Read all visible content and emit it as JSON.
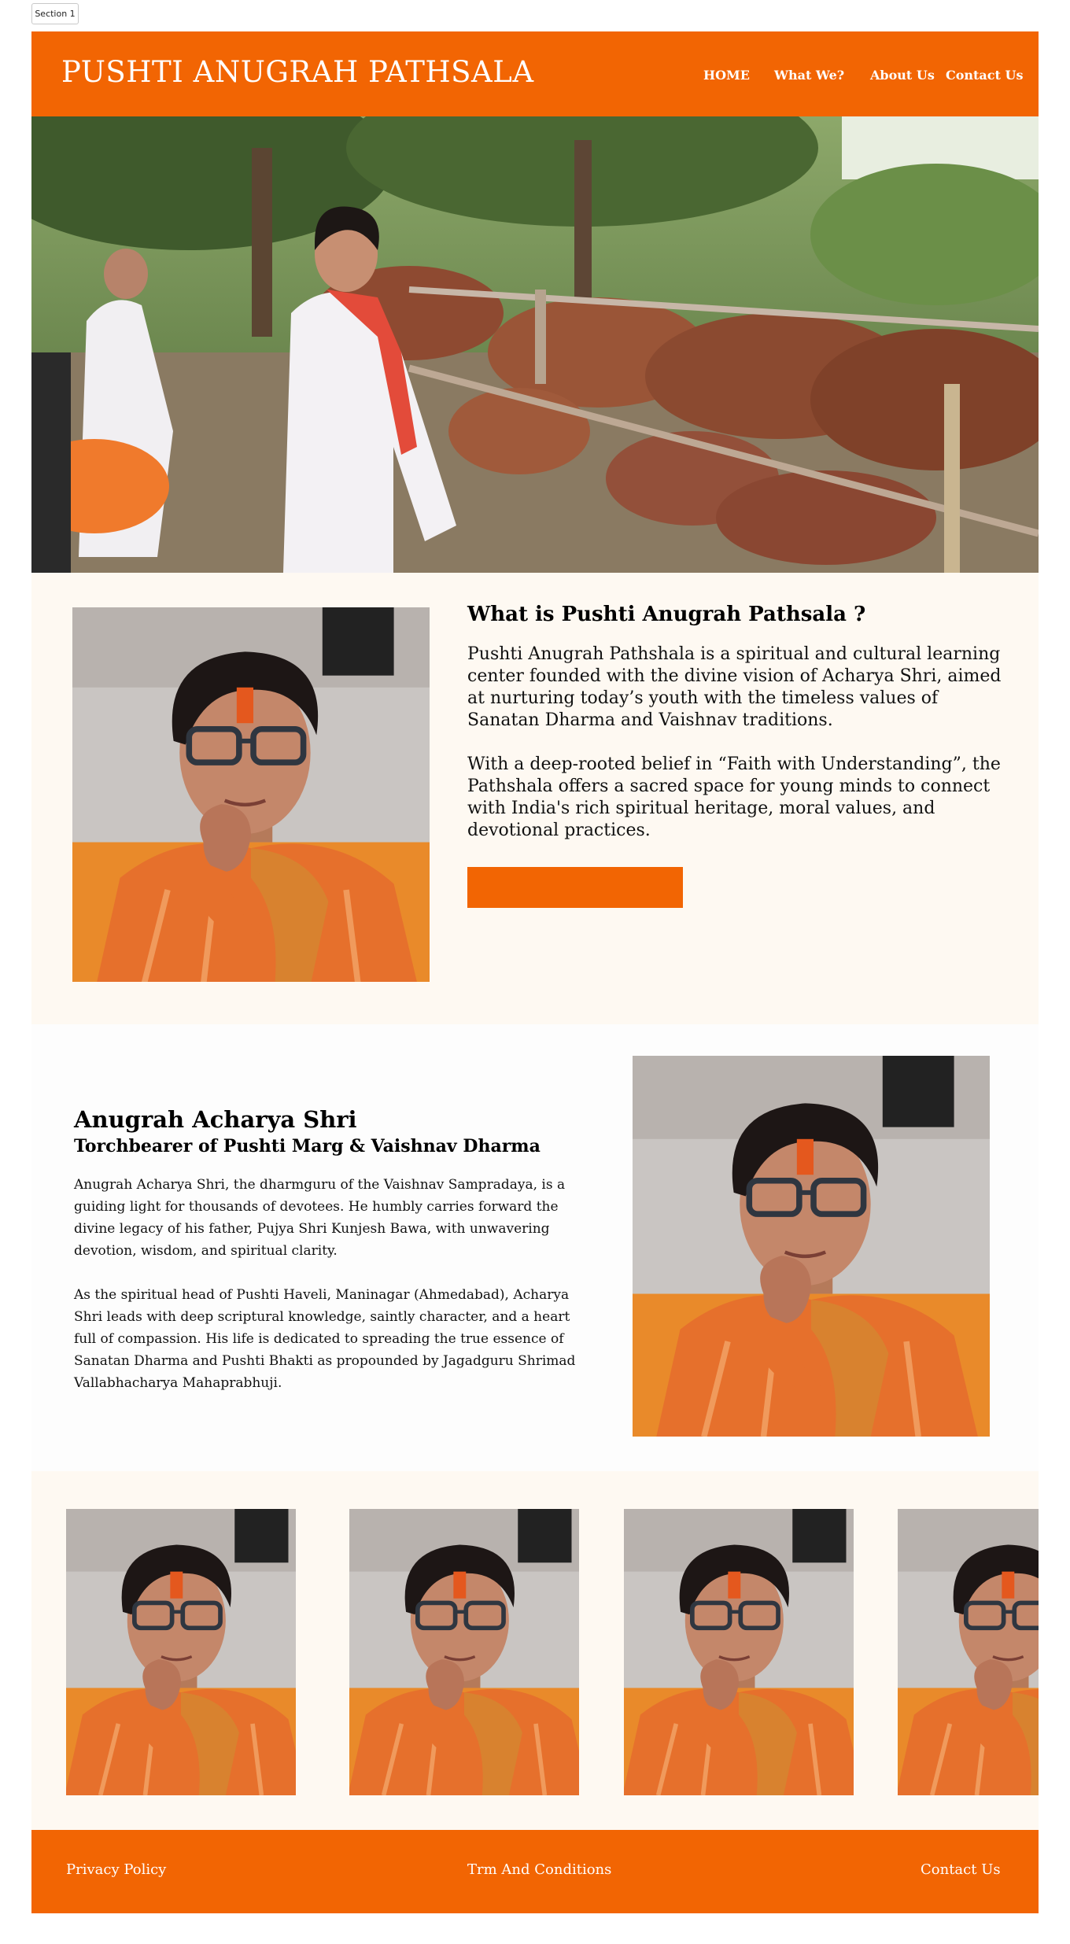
{
  "section_tag": "Section 1",
  "header": {
    "brand": "PUSHTI ANUGRAH PATHSALA",
    "nav": [
      "HOME",
      "What We?",
      "About Us",
      "Contact Us"
    ]
  },
  "about": {
    "title": "What is Pushti Anugrah Pathsala ?",
    "paragraphs": [
      "Pushti Anugrah Pathshala is a spiritual and cultural learning center founded with the divine vision of Acharya Shri, aimed at nurturing today’s youth with the timeless values of Sanatan Dharma and Vaishnav traditions.",
      "With a deep-rooted belief in “Faith with Understanding”, the Pathshala offers a sacred space for young minds to connect with India's rich spiritual heritage, moral values, and devotional practices."
    ]
  },
  "acharya": {
    "title": "Anugrah Acharya Shri",
    "subtitle": "Torchbearer of Pushti Marg & Vaishnav Dharma",
    "paragraphs": [
      "Anugrah Acharya Shri, the dharmguru of the Vaishnav Sampradaya, is a guiding light for thousands of devotees. He humbly carries forward the divine legacy of his father, Pujya Shri Kunjesh Bawa, with unwavering devotion, wisdom, and spiritual clarity.",
      "As the spiritual head of Pushti Haveli, Maninagar (Ahmedabad), Acharya Shri leads with deep scriptural knowledge, saintly character, and a heart full of compassion. His life is dedicated to spreading the true essence of Sanatan Dharma and Pushti Bhakti as propounded by Jagadguru Shrimad Vallabhacharya Mahaprabhuji."
    ]
  },
  "footer": {
    "links": [
      "Privacy Policy",
      "Trm And Conditions",
      "Contact Us"
    ]
  },
  "colors": {
    "accent": "#f26503",
    "section_bg": "#fef9f2"
  }
}
